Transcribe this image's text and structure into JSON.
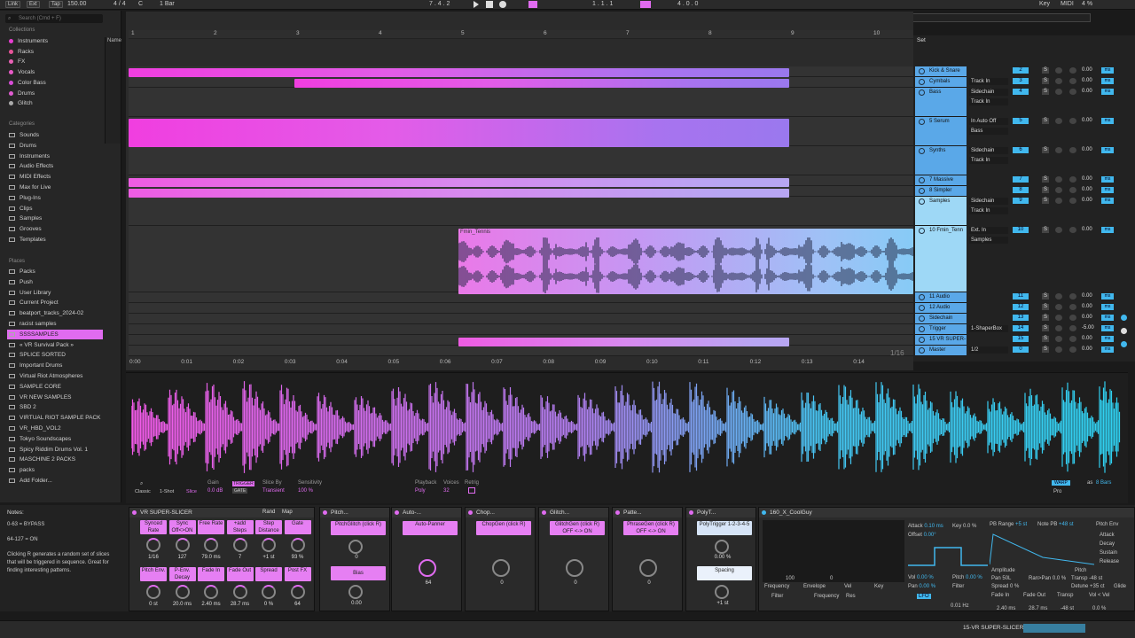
{
  "topbar": {
    "link": "Link",
    "ext": "Ext",
    "tap": "Tap",
    "tempo": "150.00",
    "sig": "4 / 4",
    "metro": "C",
    "quant": "1 Bar",
    "pos": "7 .  4 .  2",
    "loop_start": "1 .  1 .  1",
    "loop_len": "4 .  0 .  0",
    "key": "Key",
    "midi": "MIDI",
    "cpu": "4 %"
  },
  "browser": {
    "search_placeholder": "Search (Cmd + F)",
    "collections_label": "Collections",
    "collections": [
      {
        "label": "Instruments",
        "color": "#e83fd1"
      },
      {
        "label": "Racks",
        "color": "#e8559a"
      },
      {
        "label": "FX",
        "color": "#e862b5"
      },
      {
        "label": "Vocals",
        "color": "#e95ac7"
      },
      {
        "label": "Color Bass",
        "color": "#d84dd7"
      },
      {
        "label": "Drums",
        "color": "#e05bd0"
      },
      {
        "label": "Glitch",
        "color": "#aaaaaa"
      }
    ],
    "categories_label": "Categories",
    "categories": [
      "Sounds",
      "Drums",
      "Instruments",
      "Audio Effects",
      "MIDI Effects",
      "Max for Live",
      "Plug-Ins",
      "Clips",
      "Samples",
      "Grooves",
      "Templates"
    ],
    "places_label": "Places",
    "places": [
      "Packs",
      "Push",
      "User Library",
      "Current Project",
      "beatport_tracks_2024-02",
      "racist samples",
      "SSSSAMPLES",
      "« VR Survival Pack »",
      "SPLICE SORTED",
      "Important Drums",
      "Virtual Riot Atmospheres",
      "SAMPLE CORE",
      "VR NEW SAMPLES",
      "SBD 2",
      "VIRTUAL RIOT SAMPLE PACK",
      "VR_HBD_VOL2",
      "Tokyo Soundscapes",
      "Spicy Riddim Drums Vol. 1",
      "MASCHINE 2 PACKS",
      "packs",
      "Add Folder..."
    ],
    "name_col": "Name"
  },
  "ruler": {
    "bars": [
      "1",
      "2",
      "3",
      "4",
      "5",
      "6",
      "7",
      "8",
      "9",
      "10"
    ],
    "times": [
      "0:00",
      "0:01",
      "0:02",
      "0:03",
      "0:04",
      "0:05",
      "0:06",
      "0:07",
      "0:08",
      "0:09",
      "0:10",
      "0:11",
      "0:12",
      "0:13",
      "0:14"
    ],
    "zoom": "1/16"
  },
  "clip_name": "Fmin_Tennis",
  "mixer": {
    "set_label": "Set",
    "tracks": [
      {
        "name": "Kick & Snare",
        "num": "2",
        "route": "",
        "vol": "0.00"
      },
      {
        "name": "Cymbals",
        "num": "3",
        "route": "Track In",
        "vol": "0.00"
      },
      {
        "name": "Bass",
        "num": "4",
        "route": "Sidechain",
        "route2": "Track In",
        "vol": "0.00"
      },
      {
        "name": "5 Serum",
        "num": "5",
        "route": "In Auto Off",
        "route2": "Bass",
        "vol": "0.00"
      },
      {
        "name": "Synths",
        "num": "6",
        "route": "Sidechain",
        "route2": "Track In",
        "vol": "0.00"
      },
      {
        "name": "7 Massive",
        "num": "7",
        "route": "",
        "vol": "0.00"
      },
      {
        "name": "8 Simpler",
        "num": "8",
        "route": "",
        "vol": "0.00"
      },
      {
        "name": "Samples",
        "num": "9",
        "route": "Sidechain",
        "route2": "Track In",
        "vol": "0.00"
      },
      {
        "name": "10 Fmin_Tenn",
        "num": "10",
        "route": "Ext. In",
        "route2": "Samples",
        "vol": "0.00"
      },
      {
        "name": "11 Audio",
        "num": "11",
        "route": "",
        "vol": "0.00"
      },
      {
        "name": "12 Audio",
        "num": "12",
        "route": "",
        "vol": "0.00"
      },
      {
        "name": "Sidechain",
        "num": "13",
        "route": "",
        "vol": "0.00"
      },
      {
        "name": "Trigger",
        "num": "14",
        "route": "1-ShaperBox",
        "vol": "-5.00"
      },
      {
        "name": "15 VR SUPER-",
        "num": "15",
        "route": "",
        "vol": "0.00"
      },
      {
        "name": "Master",
        "num": "0",
        "route": "1/2",
        "vol": "0.00"
      }
    ]
  },
  "sample_editor": {
    "classic": "Classic",
    "oneshot": "1-Shot",
    "slice": "Slice",
    "gain_label": "Gain",
    "gain": "0.0 dB",
    "trigger": "TRIGGER",
    "gate": "GATE",
    "slice_by": "Slice By",
    "slice_mode": "Transient",
    "sensitivity_label": "Sensitivity",
    "sensitivity": "100 %",
    "playback_label": "Playback",
    "playback": "Poly",
    "voices_label": "Voices",
    "voices": "32",
    "retrig": "Retrig",
    "warp": "WARP",
    "as": "as",
    "bars": "8 Bars",
    "pro": "Pro"
  },
  "notes": {
    "title": "Notes:",
    "lines": [
      "0-63 = BYPASS",
      "",
      "64-127 = ON",
      "",
      "Clicking R generates a random set of slices that will be triggered in sequence. Great for finding interesting patterns."
    ]
  },
  "devices": {
    "slicer": {
      "title": "VR SUPER-SLICER",
      "rand": "Rand",
      "map": "Map",
      "params": [
        {
          "label": "Synced Rate",
          "val": "1/16"
        },
        {
          "label": "Sync Off<>ON",
          "val": "127"
        },
        {
          "label": "Free Rate",
          "val": "79.0 ms"
        },
        {
          "label": "+add Steps",
          "val": "7"
        },
        {
          "label": "Step Distance",
          "val": "+1 st"
        },
        {
          "label": "Gate",
          "val": "93 %"
        },
        {
          "label": "Pitch Env.",
          "val": "0 st"
        },
        {
          "label": "P-Env. Decay",
          "val": "20.0 ms"
        },
        {
          "label": "Fade In",
          "val": "2.40 ms"
        },
        {
          "label": "Fade Out",
          "val": "28.7 ms"
        },
        {
          "label": "Spread",
          "val": "0 %"
        },
        {
          "label": "Post FX",
          "val": "64"
        }
      ]
    },
    "pitch": {
      "title": "Pitch...",
      "p1": "PitchGlitch (click R)",
      "v1": "0",
      "p2": "Bias",
      "v2": "0.00"
    },
    "auto": {
      "title": "Auto-...",
      "p1": "Auto-Panner",
      "v1": "64"
    },
    "chop": {
      "title": "Chop...",
      "p1": "ChopGen (click R)",
      "v1": "0"
    },
    "glitch": {
      "title": "Glitch...",
      "p1": "GlitchGen (click R) OFF <-> ON",
      "v1": "0"
    },
    "patte": {
      "title": "Patte...",
      "p1": "PhraseGen (click R) OFF <-> ON",
      "v1": "0"
    },
    "poly": {
      "title": "PolyT...",
      "p1": "PolyTrigger 1-2-3-4-5",
      "v1": "0.00 %",
      "p2": "Spacing",
      "v2": "+1 st"
    },
    "synth": {
      "title": "160_X_CoolGuy",
      "freq": "Frequency",
      "env": "Envelope",
      "vel": "Vel",
      "key": "Key",
      "v100": "100",
      "v0": "0",
      "v0b": "0",
      "v0c": "0",
      "filter": "Filter",
      "freq2": "Frequency",
      "res": "Res",
      "attack": "Attack",
      "attack_v": "0.10 ms",
      "key_l": "Key",
      "key_v": "0.0 %",
      "offset": "Offset",
      "offset_v": "0.00°",
      "vol": "Vol",
      "vol_v": "0.00 %",
      "pitch": "Pitch",
      "pitch_v": "0.00 %",
      "pan": "Pan",
      "pan_v": "0.00 %",
      "filter2": "Filter",
      "lfo": "LFO",
      "lfo_v": "0.01 Hz",
      "pb_range": "PB Range",
      "pb_range_v": "+5 st",
      "note_pb": "Note PB",
      "note_pb_v": "+48 st",
      "pitch_env": "Pitch Env",
      "att": "Attack",
      "dec": "Decay",
      "sus": "Sustain",
      "rel": "Release",
      "amplitude": "Amplitude",
      "pitch2": "Pitch",
      "pan2": "Pan",
      "pan2_v": "50L",
      "ranpan": "Ran>Pan",
      "ranpan_v": "0.0 %",
      "transp": "Transp",
      "transp_v": "-48 st",
      "spread": "Spread",
      "spread_v": "0 %",
      "detune": "Detune",
      "detune_v": "+35 ct",
      "glide": "Glide",
      "fadein": "Fade In",
      "fadein_v": "2.40 ms",
      "fadeout": "Fade Out",
      "fadeout_v": "28.7 ms",
      "transp2": "Transp",
      "transp2_v": "-48 st",
      "volvel": "Vol < Vel",
      "volvel_v": "0.0 %"
    }
  },
  "bottom": {
    "track": "15-VR SUPER-SLICER"
  },
  "colors": {
    "pink": "#f06ae0",
    "purple": "#9b6cf0",
    "cyan": "#2cc8f0",
    "blue": "#5aa8e8"
  }
}
